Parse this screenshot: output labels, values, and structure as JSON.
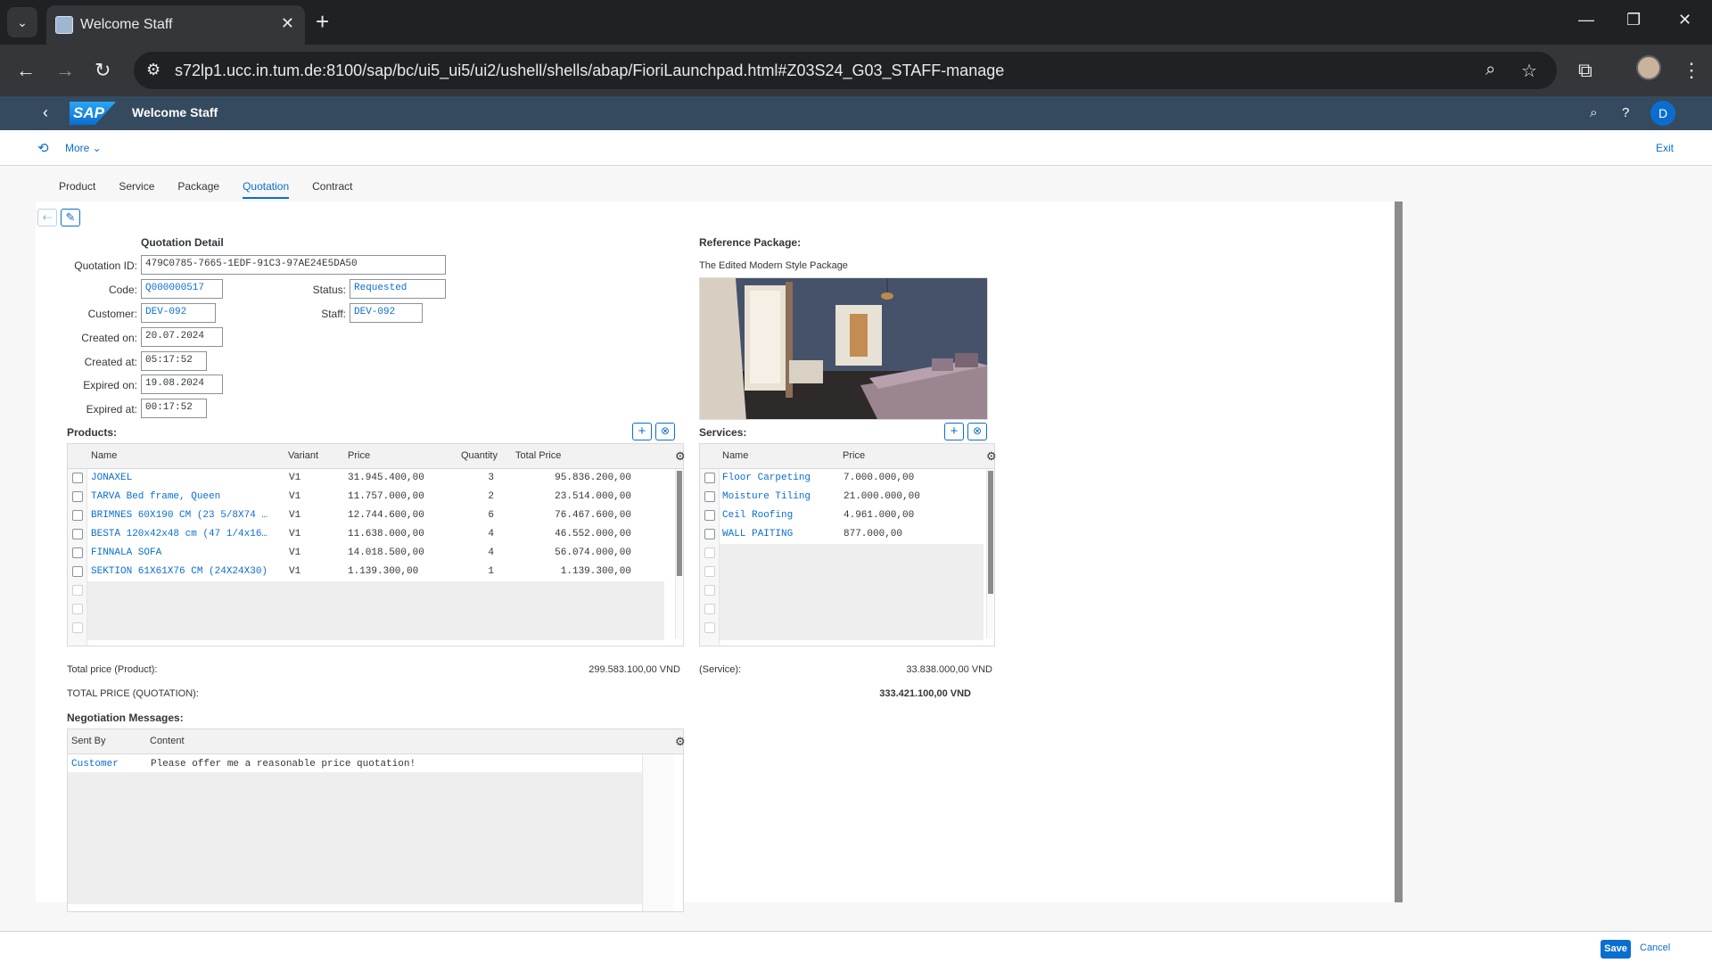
{
  "browser": {
    "tab_title": "Welcome Staff",
    "url": "s72lp1.ucc.in.tum.de:8100/sap/bc/ui5_ui5/ui2/ushell/shells/abap/FioriLaunchpad.html#Z03S24_G03_STAFF-manage"
  },
  "shell": {
    "logo_text": "SAP",
    "title": "Welcome Staff",
    "avatar_initial": "D",
    "more_label": "More",
    "exit_label": "Exit"
  },
  "tabs": [
    "Product",
    "Service",
    "Package",
    "Quotation",
    "Contract"
  ],
  "quotation": {
    "section_title": "Quotation Detail",
    "labels": {
      "id": "Quotation ID:",
      "code": "Code:",
      "status": "Status:",
      "customer": "Customer:",
      "staff": "Staff:",
      "created_on": "Created on:",
      "created_at": "Created at:",
      "expired_on": "Expired on:",
      "expired_at": "Expired at:"
    },
    "values": {
      "id": "479C0785-7665-1EDF-91C3-97AE24E5DA50",
      "code": "Q000000517",
      "status": "Requested",
      "customer": "DEV-092",
      "staff": "DEV-092",
      "created_on": "20.07.2024",
      "created_at": "05:17:52",
      "expired_on": "19.08.2024",
      "expired_at": "00:17:52"
    }
  },
  "reference": {
    "title": "Reference Package:",
    "package_name": "The Edited Modern Style Package"
  },
  "products": {
    "title": "Products:",
    "headers": [
      "Name",
      "Variant",
      "Price",
      "Quantity",
      "Total Price"
    ],
    "rows": [
      [
        "JONAXEL",
        "V1",
        "31.945.400,00",
        "3",
        "95.836.200,00"
      ],
      [
        "TARVA Bed frame,  Queen",
        "V1",
        "11.757.000,00",
        "2",
        "23.514.000,00"
      ],
      [
        "BRIMNES 60X190 CM (23 5/8X74 …",
        "V1",
        "12.744.600,00",
        "6",
        "76.467.600,00"
      ],
      [
        "BESTÅ 120x42x48 cm (47 1/4x16…",
        "V1",
        "11.638.000,00",
        "4",
        "46.552.000,00"
      ],
      [
        "FINNALA SOFA",
        "V1",
        "14.018.500,00",
        "4",
        "56.074.000,00"
      ],
      [
        "SEKTION 61X61X76 CM (24X24X30)",
        "V1",
        "1.139.300,00",
        "1",
        "1.139.300,00"
      ]
    ]
  },
  "services": {
    "title": "Services:",
    "headers": [
      "Name",
      "Price"
    ],
    "rows": [
      [
        "Floor Carpeting",
        "7.000.000,00"
      ],
      [
        "Moisture Tiling",
        "21.000.000,00"
      ],
      [
        "Ceil Roofing",
        "4.961.000,00"
      ],
      [
        "WALL PAITING",
        "877.000,00"
      ]
    ]
  },
  "totals": {
    "product_label": "Total price (Product):",
    "product_value": "299.583.100,00 VND",
    "service_label": "(Service):",
    "service_value": "33.838.000,00 VND",
    "quotation_label": "TOTAL PRICE (QUOTATION):",
    "quotation_value": "333.421.100,00 VND"
  },
  "messages": {
    "title": "Negotiation Messages:",
    "headers": [
      "Sent By",
      "Content"
    ],
    "rows": [
      [
        "Customer",
        "Please offer me a reasonable price quotation!"
      ]
    ]
  },
  "footer": {
    "save_label": "Save",
    "cancel_label": "Cancel"
  }
}
